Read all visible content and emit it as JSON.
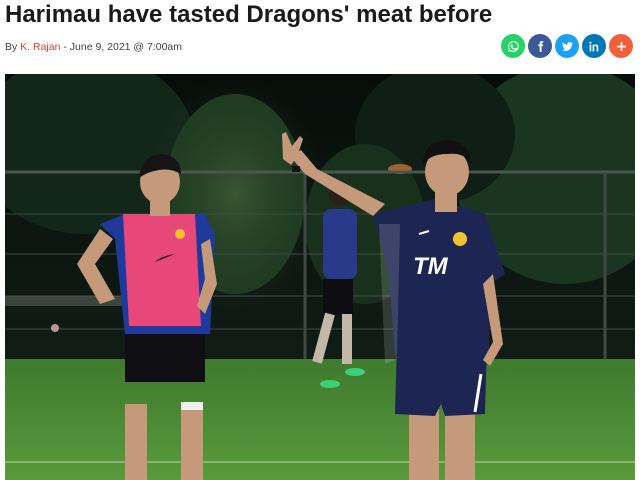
{
  "article": {
    "headline": "Harimau have tasted Dragons' meat before",
    "byline_prefix": "By ",
    "author": "K. Rajan",
    "byline_date": " - June 9, 2021 @ 7:00am"
  },
  "share_buttons": [
    {
      "icon": "whatsapp-icon",
      "color": "#25d366"
    },
    {
      "icon": "facebook-icon",
      "color": "#3b5998"
    },
    {
      "icon": "twitter-icon",
      "color": "#1da1f2"
    },
    {
      "icon": "linkedin-icon",
      "color": "#0077b5"
    },
    {
      "icon": "plus-icon",
      "color": "#f2603a"
    }
  ],
  "photo": {
    "jersey_logo": "TM",
    "colors": {
      "sky": "#0c1510",
      "trees": "#1f3a22",
      "grass": "#4d8a36",
      "coach_shirt": "#1d2552",
      "bib": "#e8477a"
    }
  }
}
